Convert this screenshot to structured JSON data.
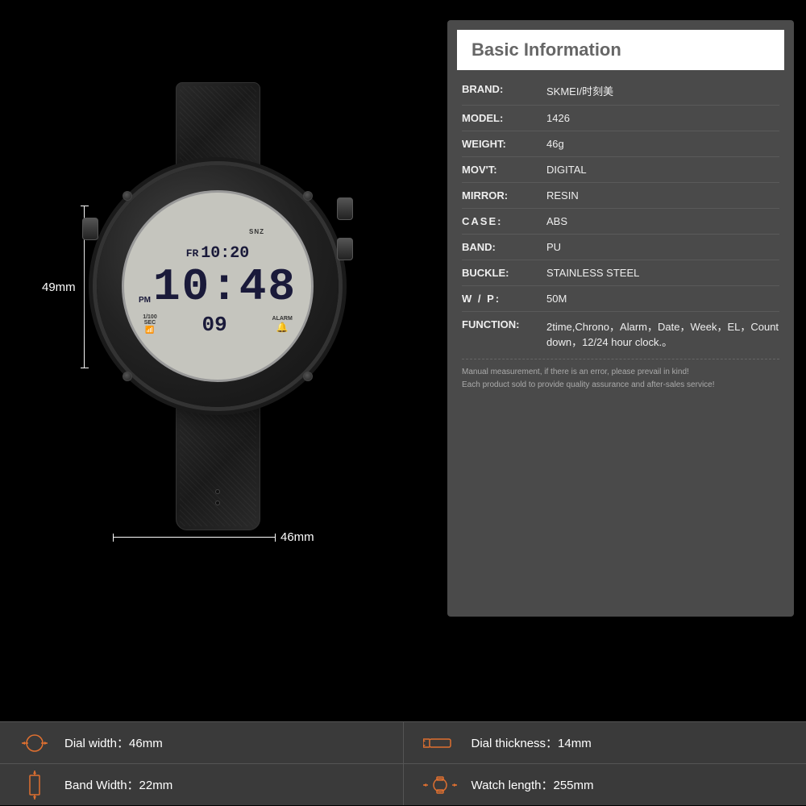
{
  "page": {
    "background": "#000000"
  },
  "watch": {
    "display": {
      "snz": "SNZ",
      "day": "FR",
      "top_time": "10:20",
      "pm": "PM",
      "main_time": "10:48",
      "sec_label": "1/100\nSEC",
      "sub_time": "09",
      "alarm_label": "ALARM"
    },
    "dim_height": "49mm",
    "dim_width": "46mm"
  },
  "info_panel": {
    "title": "Basic Information",
    "rows": [
      {
        "label": "BRAND:",
        "value": "SKMEI/时刻美"
      },
      {
        "label": "MODEL:",
        "value": "1426"
      },
      {
        "label": "WEIGHT:",
        "value": "46g"
      },
      {
        "label": "MOV'T:",
        "value": "DIGITAL"
      },
      {
        "label": "MIRROR:",
        "value": "RESIN"
      },
      {
        "label": "CASE:",
        "value": "ABS"
      },
      {
        "label": "BAND:",
        "value": "PU"
      },
      {
        "label": "BUCKLE:",
        "value": "STAINLESS STEEL"
      },
      {
        "label": "W / P:",
        "value": "50M"
      },
      {
        "label": "FUNCTION:",
        "value": "2time,Chrono，Alarm，Date，Week，EL，Count down，12/24 hour clock.。"
      }
    ],
    "note": "Manual measurement, if there is an error, please prevail in kind!\nEach product sold to provide quality assurance and after-sales service!"
  },
  "specs": {
    "row1": [
      {
        "icon": "⊙",
        "label": "Dial width：46mm"
      },
      {
        "icon": "▭",
        "label": "Dial thickness：14mm"
      }
    ],
    "row2": [
      {
        "icon": "▯",
        "label": "Band Width：22mm"
      },
      {
        "icon": "◎",
        "label": "Watch length：255mm"
      }
    ]
  }
}
